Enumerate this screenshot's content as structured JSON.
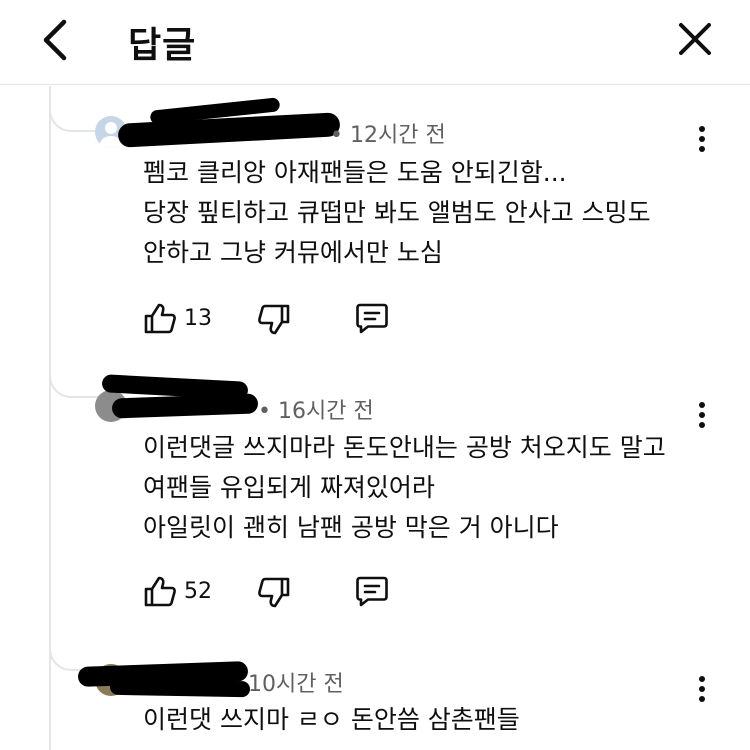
{
  "header": {
    "title": "답글",
    "back_icon": "chevron-left-icon",
    "close_icon": "close-icon"
  },
  "comments": [
    {
      "time": "12시간 전",
      "lines": [
        "펨코 클리앙 아재팬들은 도움 안되긴함...",
        "당장 핖티하고 큐떱만 봐도 앨범도 안사고 스밍도",
        "안하고 그냥 커뮤에서만 노심"
      ],
      "likes": "13"
    },
    {
      "time": "16시간 전",
      "lines": [
        "이런댓글 쓰지마라 돈도안내는 공방 처오지도 말고",
        "여팬들 유입되게 짜져있어라",
        "아일릿이 괜히 남팬 공방 막은 거 아니다"
      ],
      "likes": "52"
    },
    {
      "time": "10시간 전",
      "lines": [
        "이런댓 쓰지마 ㄹㅇ 돈안씀 삼촌팬들"
      ],
      "likes": ""
    }
  ],
  "icons": {
    "like": "thumbs-up-icon",
    "dislike": "thumbs-down-icon",
    "reply": "reply-icon",
    "more": "more-vertical-icon"
  }
}
